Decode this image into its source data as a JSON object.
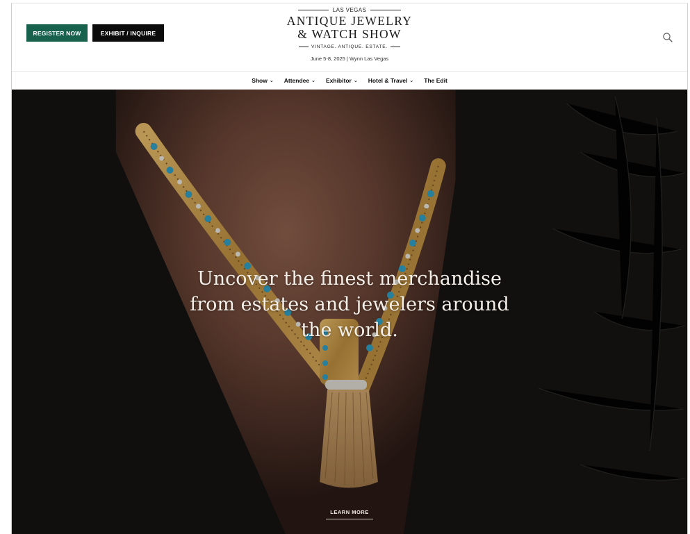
{
  "header": {
    "register_label": "REGISTER NOW",
    "exhibit_label": "EXHIBIT / INQUIRE",
    "logo": {
      "city": "LAS VEGAS",
      "title_line1": "ANTIQUE JEWELRY",
      "title_line2": "& WATCH SHOW",
      "tagline": "VINTAGE. ANTIQUE. ESTATE.",
      "date_location": "June 5-8, 2025 | Wynn Las Vegas"
    },
    "search_icon": "search-icon"
  },
  "nav": {
    "items": [
      {
        "label": "Show",
        "has_dropdown": true
      },
      {
        "label": "Attendee",
        "has_dropdown": true
      },
      {
        "label": "Exhibitor",
        "has_dropdown": true
      },
      {
        "label": "Hotel & Travel",
        "has_dropdown": true
      },
      {
        "label": "The Edit",
        "has_dropdown": false
      }
    ],
    "dropdown_icon": "chevron-down-icon"
  },
  "hero": {
    "headline_line1": "Uncover the finest merchandise",
    "headline_line2": "from estates and jewelers around",
    "headline_line3": "the world.",
    "cta_label": "LEARN MORE"
  },
  "colors": {
    "register_bg": "#17614d",
    "exhibit_bg": "#0b0b0b",
    "gold": "#c99a4a",
    "turquoise": "#2f9bbf"
  }
}
